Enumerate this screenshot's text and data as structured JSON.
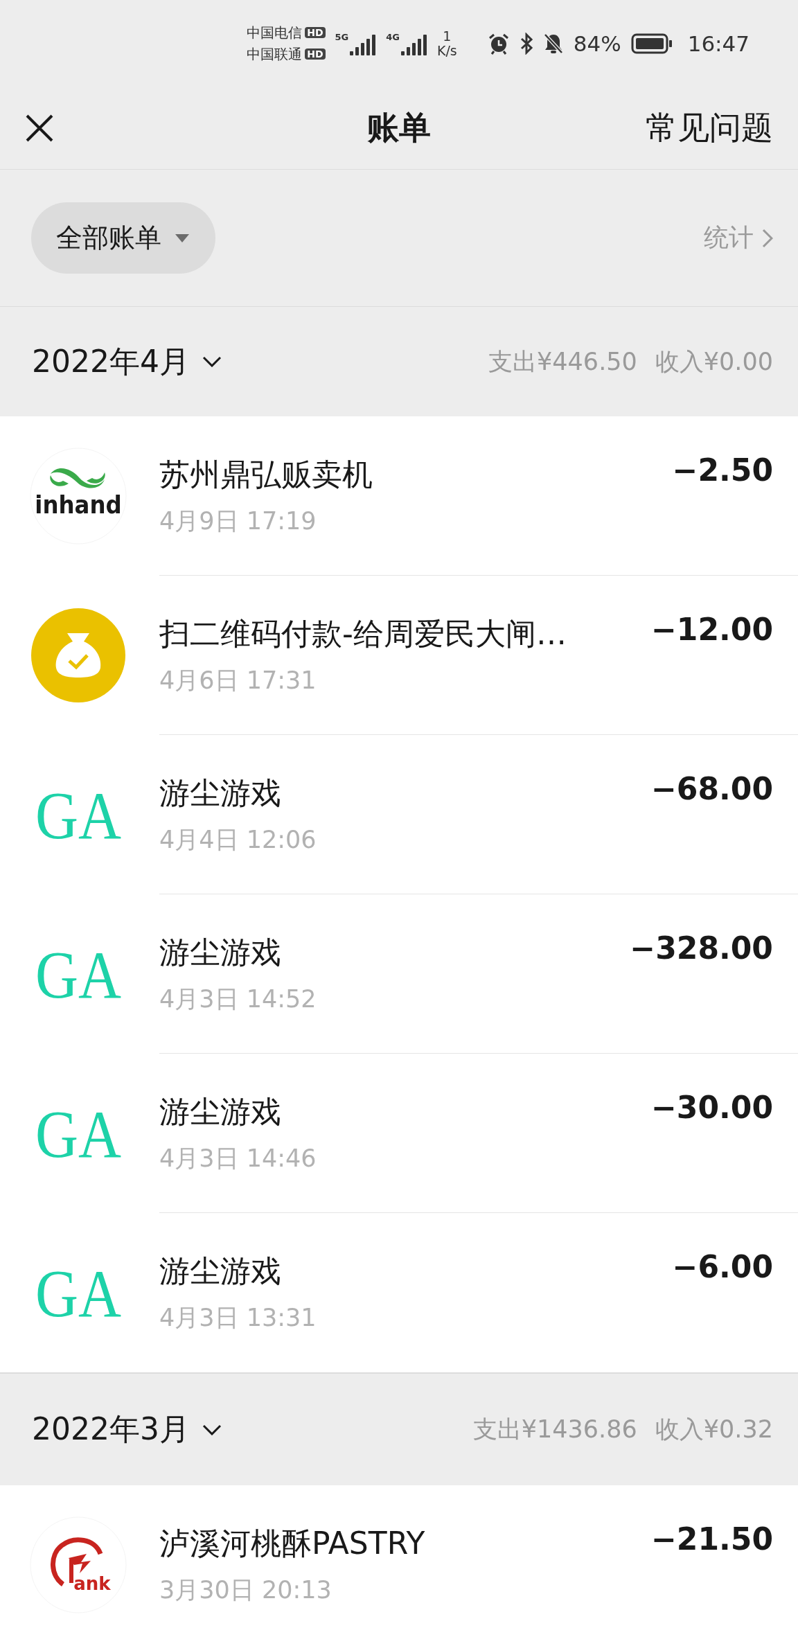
{
  "status_bar": {
    "carriers": [
      {
        "name": "中国电信",
        "badge": "HD"
      },
      {
        "name": "中国联通",
        "badge": "HD"
      }
    ],
    "networks": [
      "5G",
      "4G"
    ],
    "speed": {
      "value": "1",
      "unit": "K/s"
    },
    "battery": "84%",
    "time": "16:47"
  },
  "nav": {
    "title": "账单",
    "action": "常见问题"
  },
  "filter": {
    "label": "全部账单",
    "stats": "统计"
  },
  "months": [
    {
      "title": "2022年4月",
      "expense": "支出¥446.50",
      "income": "收入¥0.00",
      "bills": [
        {
          "logo": {
            "kind": "inhand",
            "text": "inhand"
          },
          "name": "苏州鼎弘贩卖机",
          "time": "4月9日 17:19",
          "amount": "−2.50"
        },
        {
          "logo": {
            "kind": "wallet"
          },
          "name": "扫二维码付款-给周爱民大闸…",
          "time": "4月6日 17:31",
          "amount": "−12.00"
        },
        {
          "logo": {
            "kind": "ga",
            "text": "GA"
          },
          "name": "游尘游戏",
          "time": "4月4日 12:06",
          "amount": "−68.00"
        },
        {
          "logo": {
            "kind": "ga",
            "text": "GA"
          },
          "name": "游尘游戏",
          "time": "4月3日 14:52",
          "amount": "−328.00"
        },
        {
          "logo": {
            "kind": "ga",
            "text": "GA"
          },
          "name": "游尘游戏",
          "time": "4月3日 14:46",
          "amount": "−30.00"
        },
        {
          "logo": {
            "kind": "ga",
            "text": "GA"
          },
          "name": "游尘游戏",
          "time": "4月3日 13:31",
          "amount": "−6.00"
        }
      ]
    },
    {
      "title": "2022年3月",
      "expense": "支出¥1436.86",
      "income": "收入¥0.32",
      "bills": [
        {
          "logo": {
            "kind": "bank",
            "text": "ank"
          },
          "name": "泸溪河桃酥PASTRY",
          "time": "3月30日 20:13",
          "amount": "−21.50"
        }
      ]
    }
  ]
}
